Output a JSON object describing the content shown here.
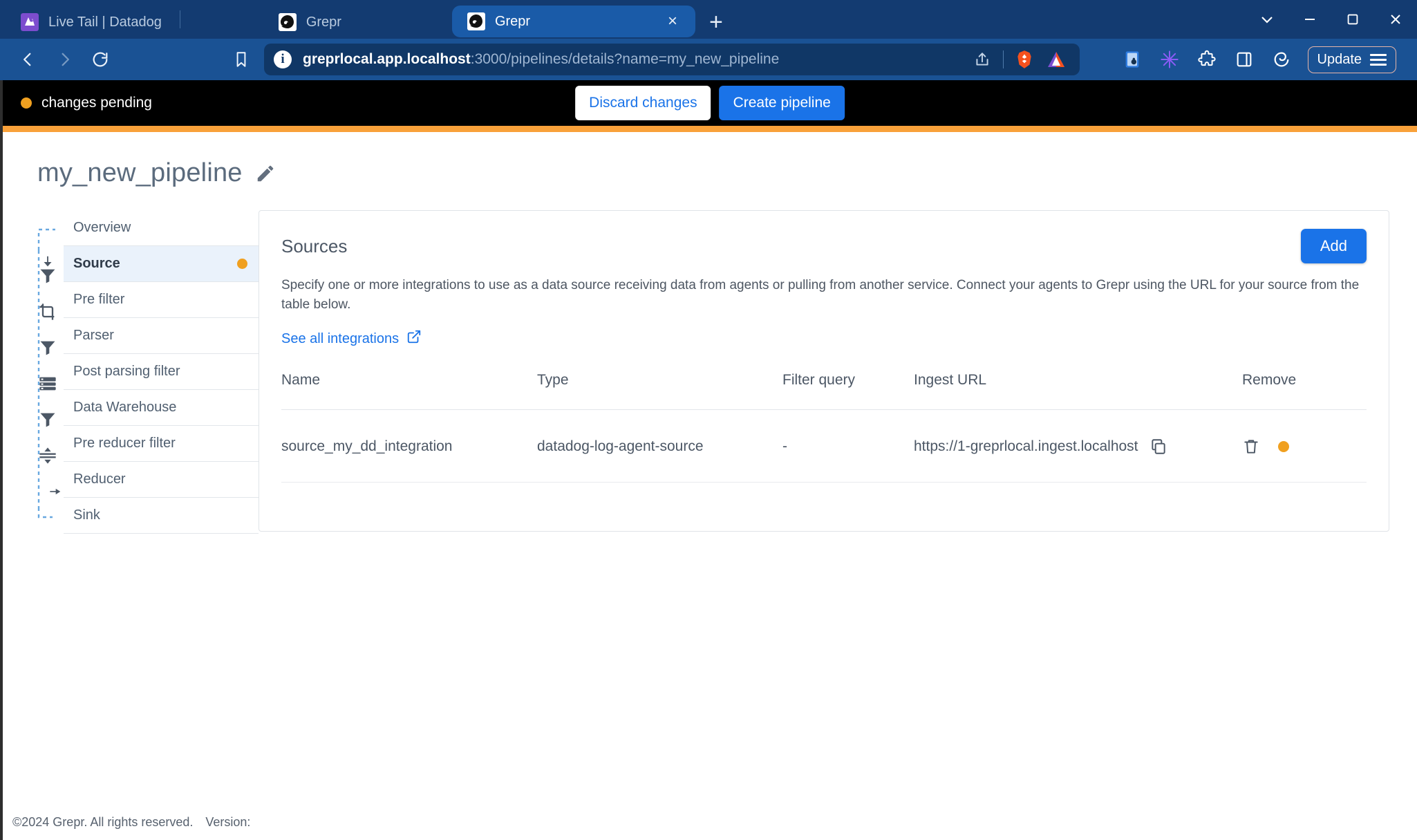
{
  "browser": {
    "tabs": [
      {
        "title": "Live Tail | Datadog",
        "icon": "datadog-favicon",
        "active": false
      },
      {
        "title": "Grepr",
        "icon": "grepr-favicon",
        "active": false
      },
      {
        "title": "Grepr",
        "icon": "grepr-favicon",
        "active": true
      }
    ],
    "new_tab_label": "+",
    "close_tab_label": "×",
    "window_controls": [
      {
        "name": "tab-search-chevron",
        "glyph": "chevron-down-icon"
      },
      {
        "name": "minimize",
        "glyph": "minimize-icon"
      },
      {
        "name": "maximize",
        "glyph": "maximize-icon"
      },
      {
        "name": "close",
        "glyph": "close-icon"
      }
    ],
    "nav": {
      "back": "back-icon",
      "forward": "forward-icon",
      "reload": "reload-icon",
      "bookmark": "bookmark-icon"
    },
    "url": {
      "host": "greprlocal.app.localhost",
      "path": ":3000/pipelines/details?name=my_new_pipeline",
      "full": "greprlocal.app.localhost:3000/pipelines/details?name=my_new_pipeline",
      "security_icon": "info-circle-icon",
      "share_icon": "share-icon",
      "brave_shields_icon": "brave-lion-icon",
      "leo_icon": "leo-ai-triangle-icon"
    },
    "extensions": [
      "password-manager-icon",
      "purple-starburst-icon",
      "puzzle-extensions-icon",
      "sidebar-panel-icon",
      "brave-rewards-icon"
    ],
    "update_button": "Update",
    "menu_icon": "hamburger-menu-icon"
  },
  "banner": {
    "status_text": "changes pending",
    "status_dot_color": "#F0A020",
    "discard_label": "Discard changes",
    "create_label": "Create pipeline",
    "accent_color": "#F9A13A",
    "background": "#000000"
  },
  "page": {
    "title": "my_new_pipeline",
    "edit_icon": "pencil-icon"
  },
  "pipeline_nav": {
    "items": [
      {
        "label": "Overview",
        "icon": "",
        "active": false,
        "dot": false
      },
      {
        "label": "Source",
        "icon": "arrow-down-icon",
        "active": true,
        "dot": true
      },
      {
        "label": "Pre filter",
        "icon": "funnel-icon",
        "active": false,
        "dot": false
      },
      {
        "label": "Parser",
        "icon": "crop-icon",
        "active": false,
        "dot": false
      },
      {
        "label": "Post parsing filter",
        "icon": "funnel-icon",
        "active": false,
        "dot": false
      },
      {
        "label": "Data Warehouse",
        "icon": "database-icon",
        "active": false,
        "dot": false
      },
      {
        "label": "Pre reducer filter",
        "icon": "funnel-icon",
        "active": false,
        "dot": false
      },
      {
        "label": "Reducer",
        "icon": "reduce-icon",
        "active": false,
        "dot": false
      },
      {
        "label": "Sink",
        "icon": "arrow-right-icon",
        "active": false,
        "dot": false
      }
    ]
  },
  "sources_card": {
    "title": "Sources",
    "add_label": "Add",
    "description": "Specify one or more integrations to use as a data source receiving data from agents or pulling from another service. Connect your agents to Grepr using the URL for your source from the table below.",
    "see_all_label": "See all integrations",
    "external_link_icon": "external-link-icon",
    "columns": [
      "Name",
      "Type",
      "Filter query",
      "Ingest URL",
      "Remove"
    ],
    "rows": [
      {
        "name": "source_my_dd_integration",
        "type": "datadog-log-agent-source",
        "filter_query": "-",
        "ingest_url": "https://1-greprlocal.ingest.localhost",
        "copy_icon": "copy-icon",
        "remove_icon": "trash-icon",
        "pending_dot": true
      }
    ]
  },
  "footer": {
    "copyright": "©2024 Grepr. All rights reserved.",
    "version_label": "Version:"
  }
}
